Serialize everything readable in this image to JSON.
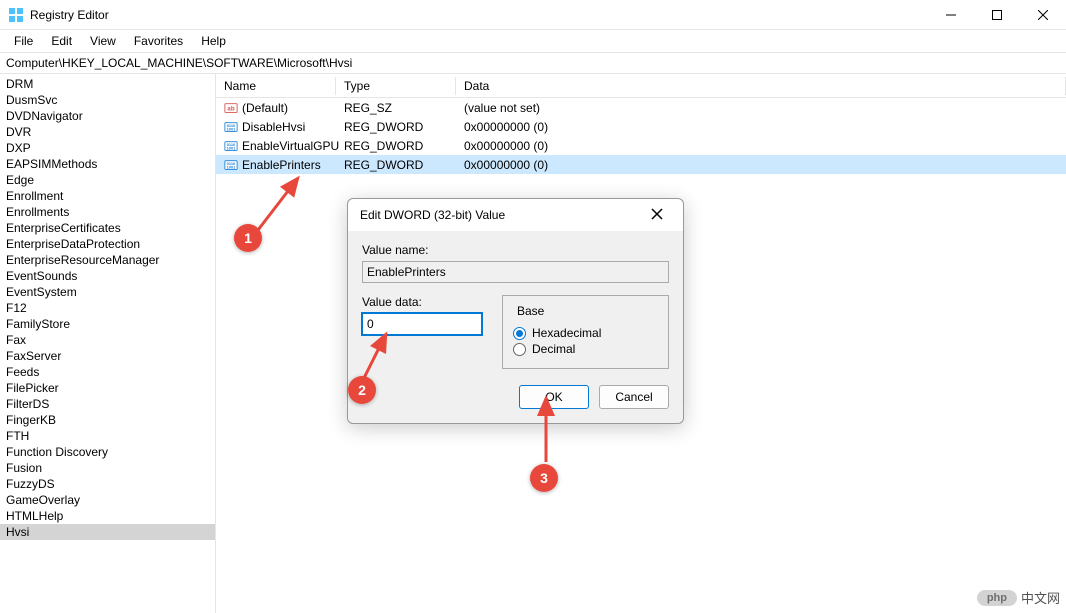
{
  "window": {
    "title": "Registry Editor"
  },
  "menu": {
    "file": "File",
    "edit": "Edit",
    "view": "View",
    "favorites": "Favorites",
    "help": "Help"
  },
  "address": "Computer\\HKEY_LOCAL_MACHINE\\SOFTWARE\\Microsoft\\Hvsi",
  "tree_items": [
    "DRM",
    "DusmSvc",
    "DVDNavigator",
    "DVR",
    "DXP",
    "EAPSIMMethods",
    "Edge",
    "Enrollment",
    "Enrollments",
    "EnterpriseCertificates",
    "EnterpriseDataProtection",
    "EnterpriseResourceManager",
    "EventSounds",
    "EventSystem",
    "F12",
    "FamilyStore",
    "Fax",
    "FaxServer",
    "Feeds",
    "FilePicker",
    "FilterDS",
    "FingerKB",
    "FTH",
    "Function Discovery",
    "Fusion",
    "FuzzyDS",
    "GameOverlay",
    "HTMLHelp",
    "Hvsi"
  ],
  "tree_selected": "Hvsi",
  "columns": {
    "name": "Name",
    "type": "Type",
    "data": "Data"
  },
  "rows": [
    {
      "icon": "string",
      "name": "(Default)",
      "type": "REG_SZ",
      "data": "(value not set)"
    },
    {
      "icon": "binary",
      "name": "DisableHvsi",
      "type": "REG_DWORD",
      "data": "0x00000000 (0)"
    },
    {
      "icon": "binary",
      "name": "EnableVirtualGPU",
      "type": "REG_DWORD",
      "data": "0x00000000 (0)"
    },
    {
      "icon": "binary",
      "name": "EnablePrinters",
      "type": "REG_DWORD",
      "data": "0x00000000 (0)",
      "selected": true
    }
  ],
  "dialog": {
    "title": "Edit DWORD (32-bit) Value",
    "value_name_label": "Value name:",
    "value_name": "EnablePrinters",
    "value_data_label": "Value data:",
    "value_data": "0",
    "base_label": "Base",
    "hex_label": "Hexadecimal",
    "dec_label": "Decimal",
    "ok": "OK",
    "cancel": "Cancel"
  },
  "callouts": {
    "c1": "1",
    "c2": "2",
    "c3": "3"
  },
  "watermark": {
    "badge": "php",
    "text": "中文网"
  }
}
